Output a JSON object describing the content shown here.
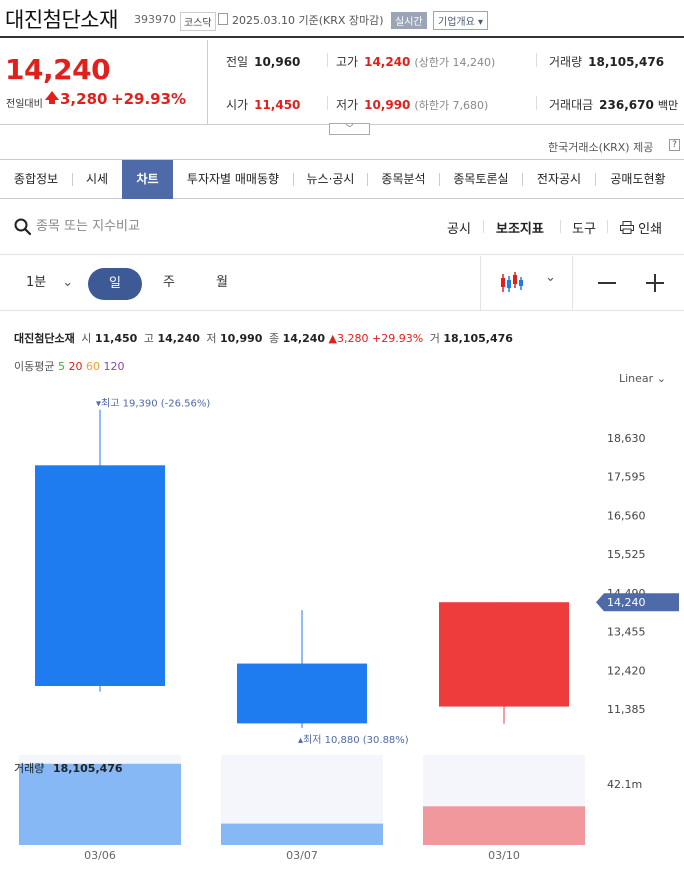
{
  "header": {
    "stock_name": "대진첨단소재",
    "stock_code": "393970",
    "market": "코스닥",
    "date_text": "2025.03.10 기준(KRX 장마감)",
    "realtime_label": "실시간",
    "company_overview_label": "기업개요"
  },
  "price": {
    "current": "14,240",
    "change_label": "전일대비",
    "change": "3,280",
    "change_pct": "+29.93%"
  },
  "stats": {
    "prev_close_label": "전일",
    "prev_close": "10,960",
    "high_label": "고가",
    "high": "14,240",
    "upper_limit": "(상한가 14,240)",
    "volume_label": "거래량",
    "volume": "18,105,476",
    "open_label": "시가",
    "open": "11,450",
    "low_label": "저가",
    "low": "10,990",
    "lower_limit": "(하한가 7,680)",
    "amount_label": "거래대금",
    "amount": "236,670",
    "amount_unit": "백만"
  },
  "source_note": "한국거래소(KRX) 제공",
  "source_help": "?",
  "tabs": [
    "종합정보",
    "시세",
    "차트",
    "투자자별 매매동향",
    "뉴스·공시",
    "종목분석",
    "종목토론실",
    "전자공시",
    "공매도현황"
  ],
  "active_tab": "차트",
  "search": {
    "placeholder": "종목 또는 지수비교"
  },
  "tools": {
    "disclosure": "공시",
    "indicator": "보조지표",
    "tool": "도구",
    "print": "인쇄"
  },
  "periods": {
    "minute": "1분",
    "day": "일",
    "week": "주",
    "month": "월"
  },
  "info_line": {
    "name": "대진첨단소재",
    "open_k": "시",
    "open": "11,450",
    "high_k": "고",
    "high": "14,240",
    "low_k": "저",
    "low": "10,990",
    "close_k": "종",
    "close": "14,240",
    "change": "3,280",
    "change_pct": "+29.93%",
    "vol_k": "거",
    "vol": "18,105,476"
  },
  "ma": {
    "label": "이동평균",
    "p5": "5",
    "p20": "20",
    "p60": "60",
    "p120": "120",
    "colors": {
      "p5": "#3cb043",
      "p20": "#e0201c",
      "p60": "#f0a030",
      "p120": "#8e44ad"
    }
  },
  "scale_label": "Linear",
  "colors": {
    "up": "#ee3b3b",
    "down": "#1e7cf0",
    "vol_up": "#f0989c",
    "vol_down": "#86b8f5",
    "accent": "#4e6aa8"
  },
  "chart_data": {
    "type": "candlestick",
    "categories": [
      "03/06",
      "03/07",
      "03/10"
    ],
    "candles": [
      {
        "date": "03/06",
        "open": 17900,
        "high": 19390,
        "low": 11850,
        "close": 12000,
        "volume": 38000000
      },
      {
        "date": "03/07",
        "open": 12600,
        "high": 14030,
        "low": 10880,
        "close": 11000,
        "volume": 10000000
      },
      {
        "date": "03/10",
        "open": 11450,
        "high": 14240,
        "low": 10990,
        "close": 14240,
        "volume": 18105476
      }
    ],
    "y_ticks": [
      "18,630",
      "17,595",
      "16,560",
      "15,525",
      "14,490",
      "13,455",
      "12,420",
      "11,385"
    ],
    "ylim": [
      10960,
      19810
    ],
    "current_price_label": "14,240",
    "max_annotation": "최고 19,390 (-26.56%)",
    "min_annotation": "최저 10,880 (30.88%)",
    "volume_label": "거래량",
    "volume_value": "18,105,476",
    "volume_tick": "42.1m",
    "volume_max": 42100000
  }
}
